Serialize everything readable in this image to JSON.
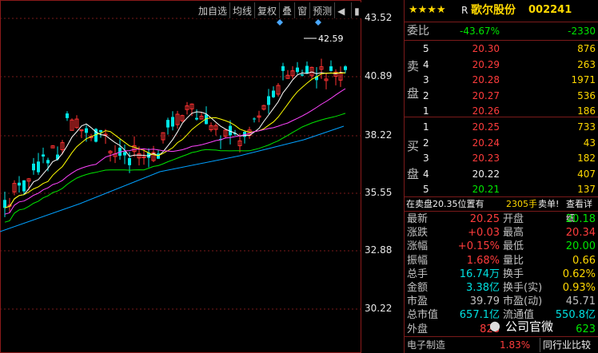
{
  "toolbar": {
    "add_favorite": "加自选",
    "cross": "均线",
    "restore_rights": "复权",
    "overlay": "叠",
    "window": "窗",
    "forecast": "预测"
  },
  "chart": {
    "price_ticks": [
      "43.52",
      "40.89",
      "38.22",
      "35.55",
      "32.88",
      "30.22"
    ],
    "high_label": "42.59",
    "colors": {
      "up": "#ff3232",
      "down": "#00e6e6",
      "ma5": "#ffffff",
      "ma10": "#ffff00",
      "ma20": "#ff44ff",
      "ma30": "#00e600",
      "ma60": "#00a0ff"
    }
  },
  "stock": {
    "stars": "★★★★",
    "tag": "R",
    "name": "歌尔股份",
    "code": "002241"
  },
  "committee": {
    "label": "委比",
    "ratio": "-43.67%",
    "diff": "-2330"
  },
  "sell_side_label": [
    "卖",
    "盘"
  ],
  "buy_side_label": [
    "买",
    "盘"
  ],
  "sell_orders": [
    {
      "level": "5",
      "price": "20.30",
      "volume": "876"
    },
    {
      "level": "4",
      "price": "20.29",
      "volume": "263"
    },
    {
      "level": "3",
      "price": "20.28",
      "volume": "1971"
    },
    {
      "level": "2",
      "price": "20.27",
      "volume": "536"
    },
    {
      "level": "1",
      "price": "20.26",
      "volume": "186"
    }
  ],
  "buy_orders": [
    {
      "level": "1",
      "price": "20.25",
      "volume": "733"
    },
    {
      "level": "2",
      "price": "20.24",
      "volume": "43"
    },
    {
      "level": "3",
      "price": "20.23",
      "volume": "182"
    },
    {
      "level": "4",
      "price": "20.22",
      "volume": "407"
    },
    {
      "level": "5",
      "price": "20.21",
      "volume": "137"
    }
  ],
  "order_notice": {
    "text": "在卖盘20.35位置有",
    "volume": "2305手",
    "action": "卖单!",
    "link": "查看详细"
  },
  "quote": [
    {
      "l1": "最新",
      "v1": "20.25",
      "l2": "开盘",
      "v2": "20.18"
    },
    {
      "l1": "涨跌",
      "v1": "+0.03",
      "l2": "最高",
      "v2": "20.34"
    },
    {
      "l1": "涨幅",
      "v1": "+0.15%",
      "l2": "最低",
      "v2": "20.00"
    },
    {
      "l1": "振幅",
      "v1": "1.68%",
      "l2": "量比",
      "v2": "0.66"
    },
    {
      "l1": "总手",
      "v1": "16.74万",
      "l2": "换手",
      "v2": "0.62%"
    },
    {
      "l1": "金额",
      "v1": "3.38亿",
      "l2": "换手(实)",
      "v2": "0.93%"
    },
    {
      "l1": "市盈",
      "v1": "39.79",
      "l2": "市盈(动)",
      "v2": "45.71"
    },
    {
      "l1": "总市值",
      "v1": "657.1亿",
      "l2": "流通值",
      "v2": "550.8亿"
    },
    {
      "l1": "外盘",
      "v1": "828",
      "l2": "",
      "v2": "623"
    }
  ],
  "watermark": "公司官微",
  "industry": {
    "name": "电子制造",
    "change": "1.83%",
    "compare": "同行业比较"
  }
}
